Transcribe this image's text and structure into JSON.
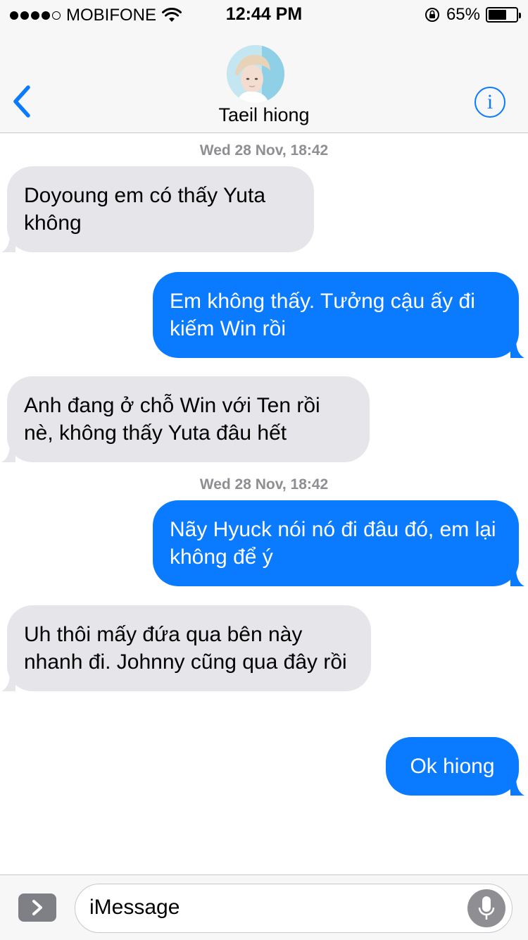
{
  "status_bar": {
    "carrier": "MOBIFONE",
    "time": "12:44 PM",
    "battery": "65%",
    "battery_level": 0.65,
    "signal_bars": 4
  },
  "header": {
    "back_icon": "chevron-left-icon",
    "contact_name": "Taeil hiong",
    "info_label": "i"
  },
  "thread": {
    "timestamps": [
      "Wed 28 Nov, 18:42",
      "Wed 28 Nov, 18:42"
    ],
    "messages": [
      {
        "direction": "incoming",
        "text": "Doyoung em có thấy Yuta không"
      },
      {
        "direction": "outgoing",
        "text": "Em không thấy. Tưởng cậu ấy đi kiếm Win rồi"
      },
      {
        "direction": "incoming",
        "text": "Anh đang ở chỗ Win với Ten rồi nè, không thấy Yuta đâu hết"
      },
      {
        "direction": "outgoing",
        "text": "Nãy Hyuck nói nó đi đâu đó, em lại không để ý"
      },
      {
        "direction": "incoming",
        "text": "Uh thôi mấy đứa qua bên này nhanh đi. Johnny cũng qua đây rồi"
      },
      {
        "direction": "outgoing",
        "text": "Ok hiong"
      }
    ]
  },
  "compose": {
    "placeholder": "iMessage",
    "app_icon": "chevron-right-icon",
    "mic_icon": "microphone-icon"
  },
  "colors": {
    "outgoing_bubble": "#0a7aff",
    "incoming_bubble": "#e5e5ea",
    "accent": "#0a7aff"
  }
}
